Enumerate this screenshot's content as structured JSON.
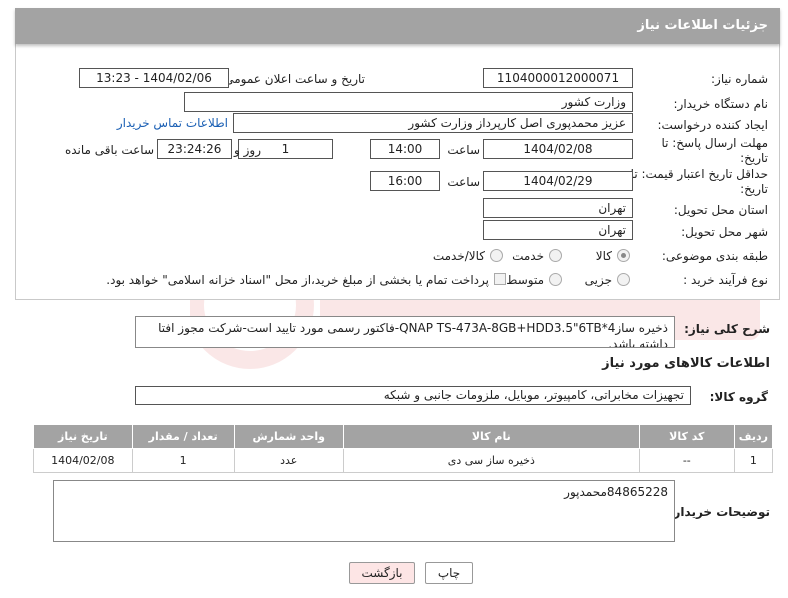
{
  "panel": {
    "title": "جزئیات اطلاعات نیاز"
  },
  "fields": {
    "need_number_label": "شماره نیاز:",
    "need_number": "1104000012000071",
    "announce_label": "تاریخ و ساعت اعلان عمومی:",
    "announce_value": "1404/02/06 - 13:23",
    "buyer_org_label": "نام دستگاه خریدار:",
    "buyer_org": "وزارت کشور",
    "creator_label": "ایجاد کننده درخواست:",
    "creator": "عزیز محمدپوری اصل کارپرداز وزارت کشور",
    "contact_link": "اطلاعات تماس خریدار",
    "reply_deadline_label": "مهلت ارسال پاسخ: تا تاریخ:",
    "reply_date": "1404/02/08",
    "time_label": "ساعت",
    "reply_time": "14:00",
    "days_value": "1",
    "days_label": "روز و",
    "remaining_time": "23:24:26",
    "remaining_label": "ساعت باقی مانده",
    "price_validity_label": "حداقل تاریخ اعتبار قیمت: تا تاریخ:",
    "price_date": "1404/02/29",
    "price_time": "16:00",
    "province_label": "استان محل تحویل:",
    "province": "تهران",
    "city_label": "شهر محل تحویل:",
    "city": "تهران",
    "category_label": "طبقه بندی موضوعی:",
    "category_options": [
      "کالا",
      "خدمت",
      "کالا/خدمت"
    ],
    "process_label": "نوع فرآیند خرید :",
    "process_options": [
      "جزیی",
      "متوسط"
    ],
    "payment_note": "پرداخت تمام یا بخشی از مبلغ خرید،از محل \"اسناد خزانه اسلامی\" خواهد بود."
  },
  "description": {
    "label": "شرح کلی نیاز:",
    "text": "ذخیره سازQNAP TS-473A-8GB+HDD3.5\"6TB*4-فاکتور رسمی مورد تایید است-شرکت مجوز افتا داشته باشد."
  },
  "goods": {
    "section_title": "اطلاعات کالاهای مورد نیاز",
    "group_label": "گروه کالا:",
    "group_value": "تجهیزات مخابراتی، کامپیوتر، موبایل، ملزومات جانبی و شبکه",
    "columns": [
      "ردیف",
      "کد کالا",
      "نام کالا",
      "واحد شمارش",
      "تعداد / مقدار",
      "تاریخ نیاز"
    ],
    "rows": [
      [
        "1",
        "--",
        "ذخیره ساز سی دی",
        "عدد",
        "1",
        "1404/02/08"
      ]
    ]
  },
  "buyer_notes": {
    "label": "توضیحات خریدار:",
    "text": "84865228محمدپور"
  },
  "buttons": {
    "print": "چاپ",
    "back": "بازگشت"
  },
  "colors": {
    "header_bg": "#a3a3a3",
    "link": "#1a5fb4",
    "back_button_bg": "#fde5e5"
  }
}
